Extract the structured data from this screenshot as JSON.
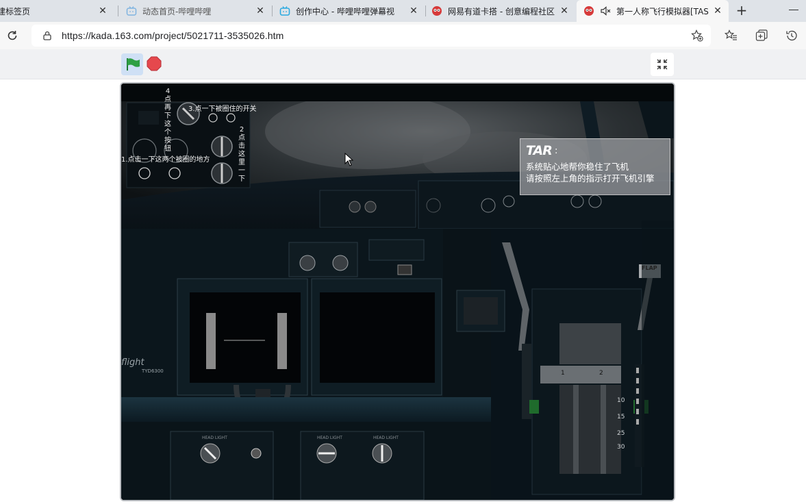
{
  "browser": {
    "tabs": [
      {
        "label": "建标签页",
        "active": false
      },
      {
        "label": "动态首页-哔哩哔哩",
        "active": false
      },
      {
        "label": "创作中心 - 哔哩哔哩弹幕视",
        "active": false
      },
      {
        "label": "网易有道卡搭 - 创意编程社区",
        "active": false
      },
      {
        "label": "第一人称飞行模拟器[TAS",
        "active": true
      }
    ],
    "url": "https://kada.163.com/project/5021711-3535026.htm"
  },
  "stage": {
    "overlay_labels": {
      "step1": "1.点击一下这两个被圈的地方",
      "step2_vertical": "2点击这里一下",
      "step3": "3.点一下被圈住的开关",
      "step4_vertical": "4点再下这个按钮"
    },
    "dialog": {
      "speaker": "TAR",
      "colon": ":",
      "line1": "系统贴心地帮你稳住了飞机",
      "line2": "请按照左上角的指示打开飞机引擎"
    },
    "cockpit_labels": {
      "flight_brand": "flight",
      "model": "TYD6300",
      "flap": "FLAP",
      "flap_marks": [
        "10",
        "15",
        "25",
        "30"
      ],
      "engine_nums": [
        "1",
        "2"
      ],
      "head_light": "HEAD LIGHT"
    }
  },
  "colors": {
    "tabstrip_bg": "#dfe3e8",
    "active_tab_bg": "#f7f7f7",
    "flag_green": "#2ea043",
    "stop_red": "#e5484d",
    "stage_bg": "#05090b"
  }
}
